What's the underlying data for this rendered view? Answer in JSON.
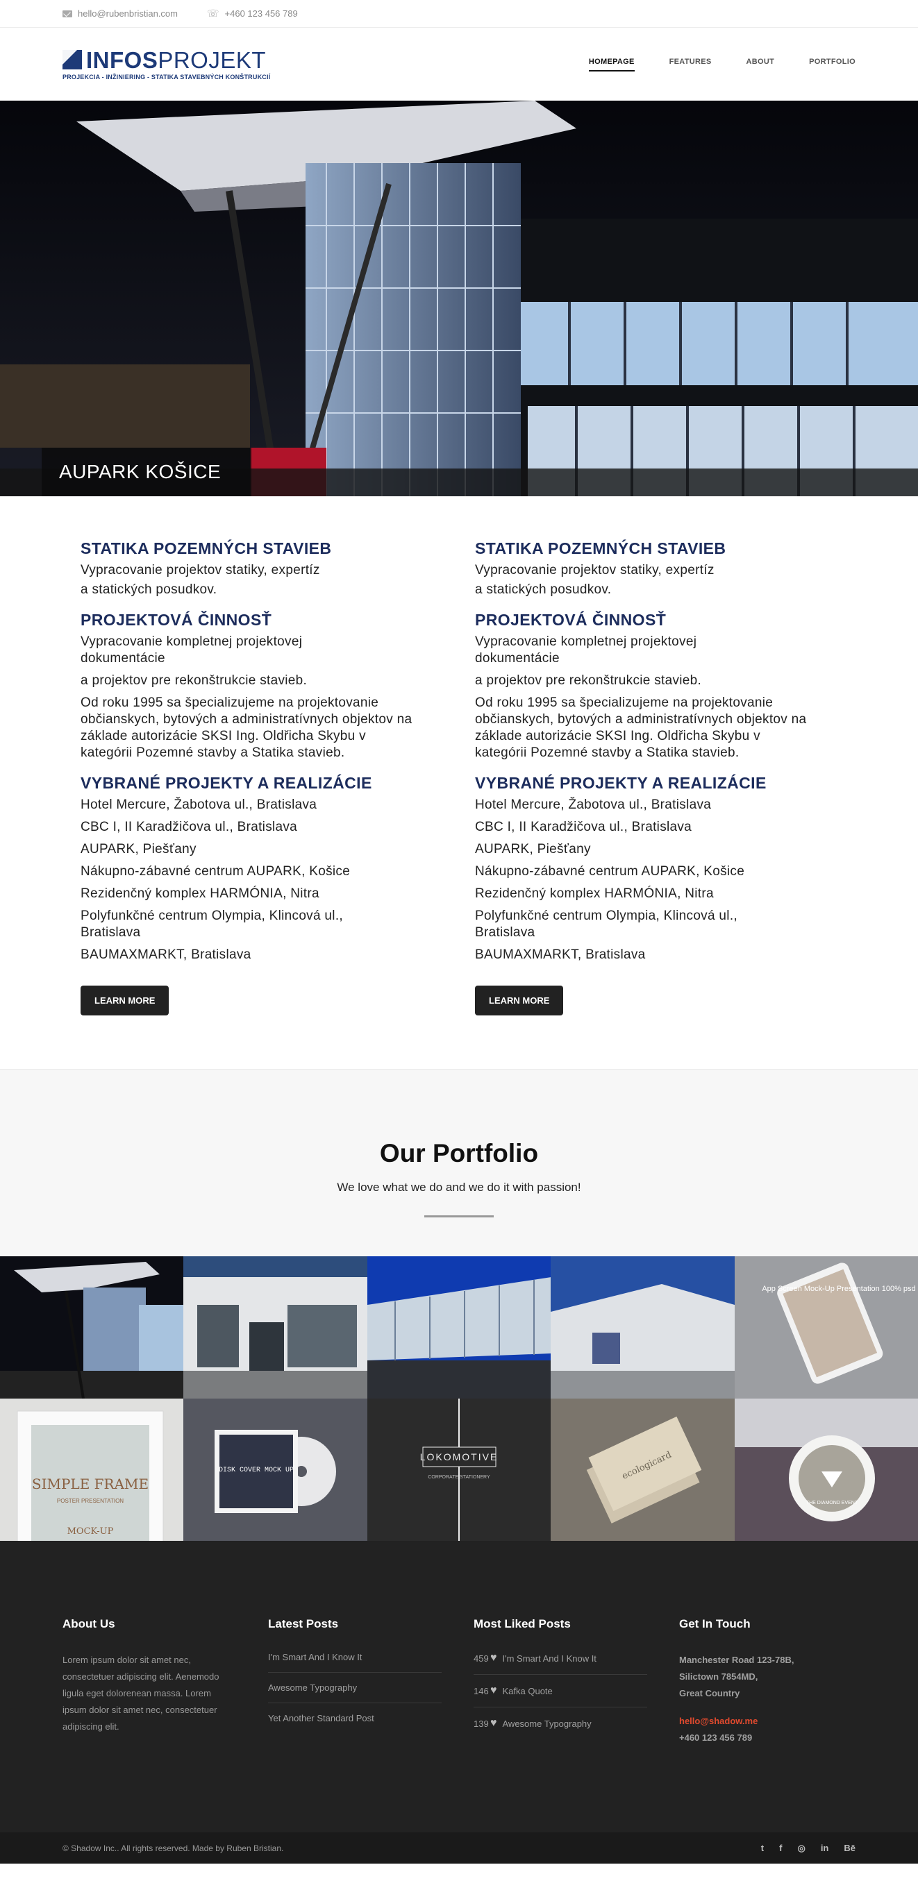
{
  "topbar": {
    "email": "hello@rubenbristian.com",
    "phone": "+460 123 456 789"
  },
  "header": {
    "logo_bold": "INFOS",
    "logo_light": "PROJEKT",
    "logo_sub": "PROJEKCIA - INŽINIERING - STATIKA STAVEBNÝCH KONŠTRUKCIÍ",
    "nav": [
      "HOMEPAGE",
      "FEATURES",
      "ABOUT",
      "PORTFOLIO"
    ]
  },
  "hero": {
    "caption": "AUPARK KOŠICE"
  },
  "services": {
    "h1": "STATIKA POZEMNÝCH STAVIEB",
    "p1a": "Vypracovanie projektov statiky, expertíz",
    "p1b": "a statických posudkov.",
    "h2": "PROJEKTOVÁ ČINNOSŤ",
    "p2a": "Vypracovanie kompletnej projektovej dokumentácie",
    "p2b": "a projektov pre rekonštrukcie stavieb.",
    "p2c": "Od roku 1995 sa špecializujeme na projektovanie občianskych, bytových a administratívnych objektov na základe autorizácie SKSI Ing. Oldřicha Skybu v kategórii Pozemné stavby a Statika stavieb.",
    "h3": "VYBRANÉ PROJEKTY A REALIZÁCIE",
    "projects": [
      "Hotel Mercure, Žabotova ul., Bratislava",
      "CBC I, II Karadžičova ul., Bratislava",
      "AUPARK, Piešťany",
      "Nákupno-zábavné centrum AUPARK, Košice",
      "Rezidenčný komplex HARMÓNIA, Nitra",
      "Polyfunkčné centrum Olympia, Klincová ul., Bratislava",
      "BAUMAXMARKT, Bratislava"
    ],
    "button": "LEARN MORE"
  },
  "portfolio": {
    "title": "Our Portfolio",
    "tagline": "We love what we do and we do it with passion!"
  },
  "tiles": {
    "t5": "App Screen Mock-Up Presentation 100% psd",
    "t6a": "SIMPLE FRAME",
    "t6b": "POSTER PRESENTATION",
    "t6c": "MOCK-UP",
    "t7": "DISK COVER MOCK UP",
    "t8a": "LOKOMOTIVE",
    "t8b": "CORPORATE STATIONERY",
    "t9": "ecologicard",
    "t10": "THE DIAMOND EVENT"
  },
  "footer": {
    "about_title": "About Us",
    "about_text": "Lorem ipsum dolor sit amet nec, consectetuer adipiscing elit. Aenemodo ligula eget dolorenean massa. Lorem ipsum dolor sit amet nec, consectetuer adipiscing elit.",
    "latest_title": "Latest Posts",
    "latest": [
      "I'm Smart And I Know It",
      "Awesome Typography",
      "Yet Another Standard Post"
    ],
    "liked_title": "Most Liked Posts",
    "liked": [
      {
        "count": "459",
        "title": "I'm Smart And I Know It"
      },
      {
        "count": "146",
        "title": "Kafka Quote"
      },
      {
        "count": "139",
        "title": "Awesome Typography"
      }
    ],
    "touch_title": "Get In Touch",
    "addr1": "Manchester Road 123-78B,",
    "addr2": "Silictown 7854MD,",
    "addr3": "Great Country",
    "email": "hello@shadow.me",
    "phone": "+460 123 456 789",
    "copyright": "© Shadow Inc.. All rights reserved. Made by Ruben Bristian.",
    "socials": [
      "twitter-icon",
      "facebook-icon",
      "dribbble-icon",
      "linkedin-icon",
      "behance-icon"
    ]
  }
}
